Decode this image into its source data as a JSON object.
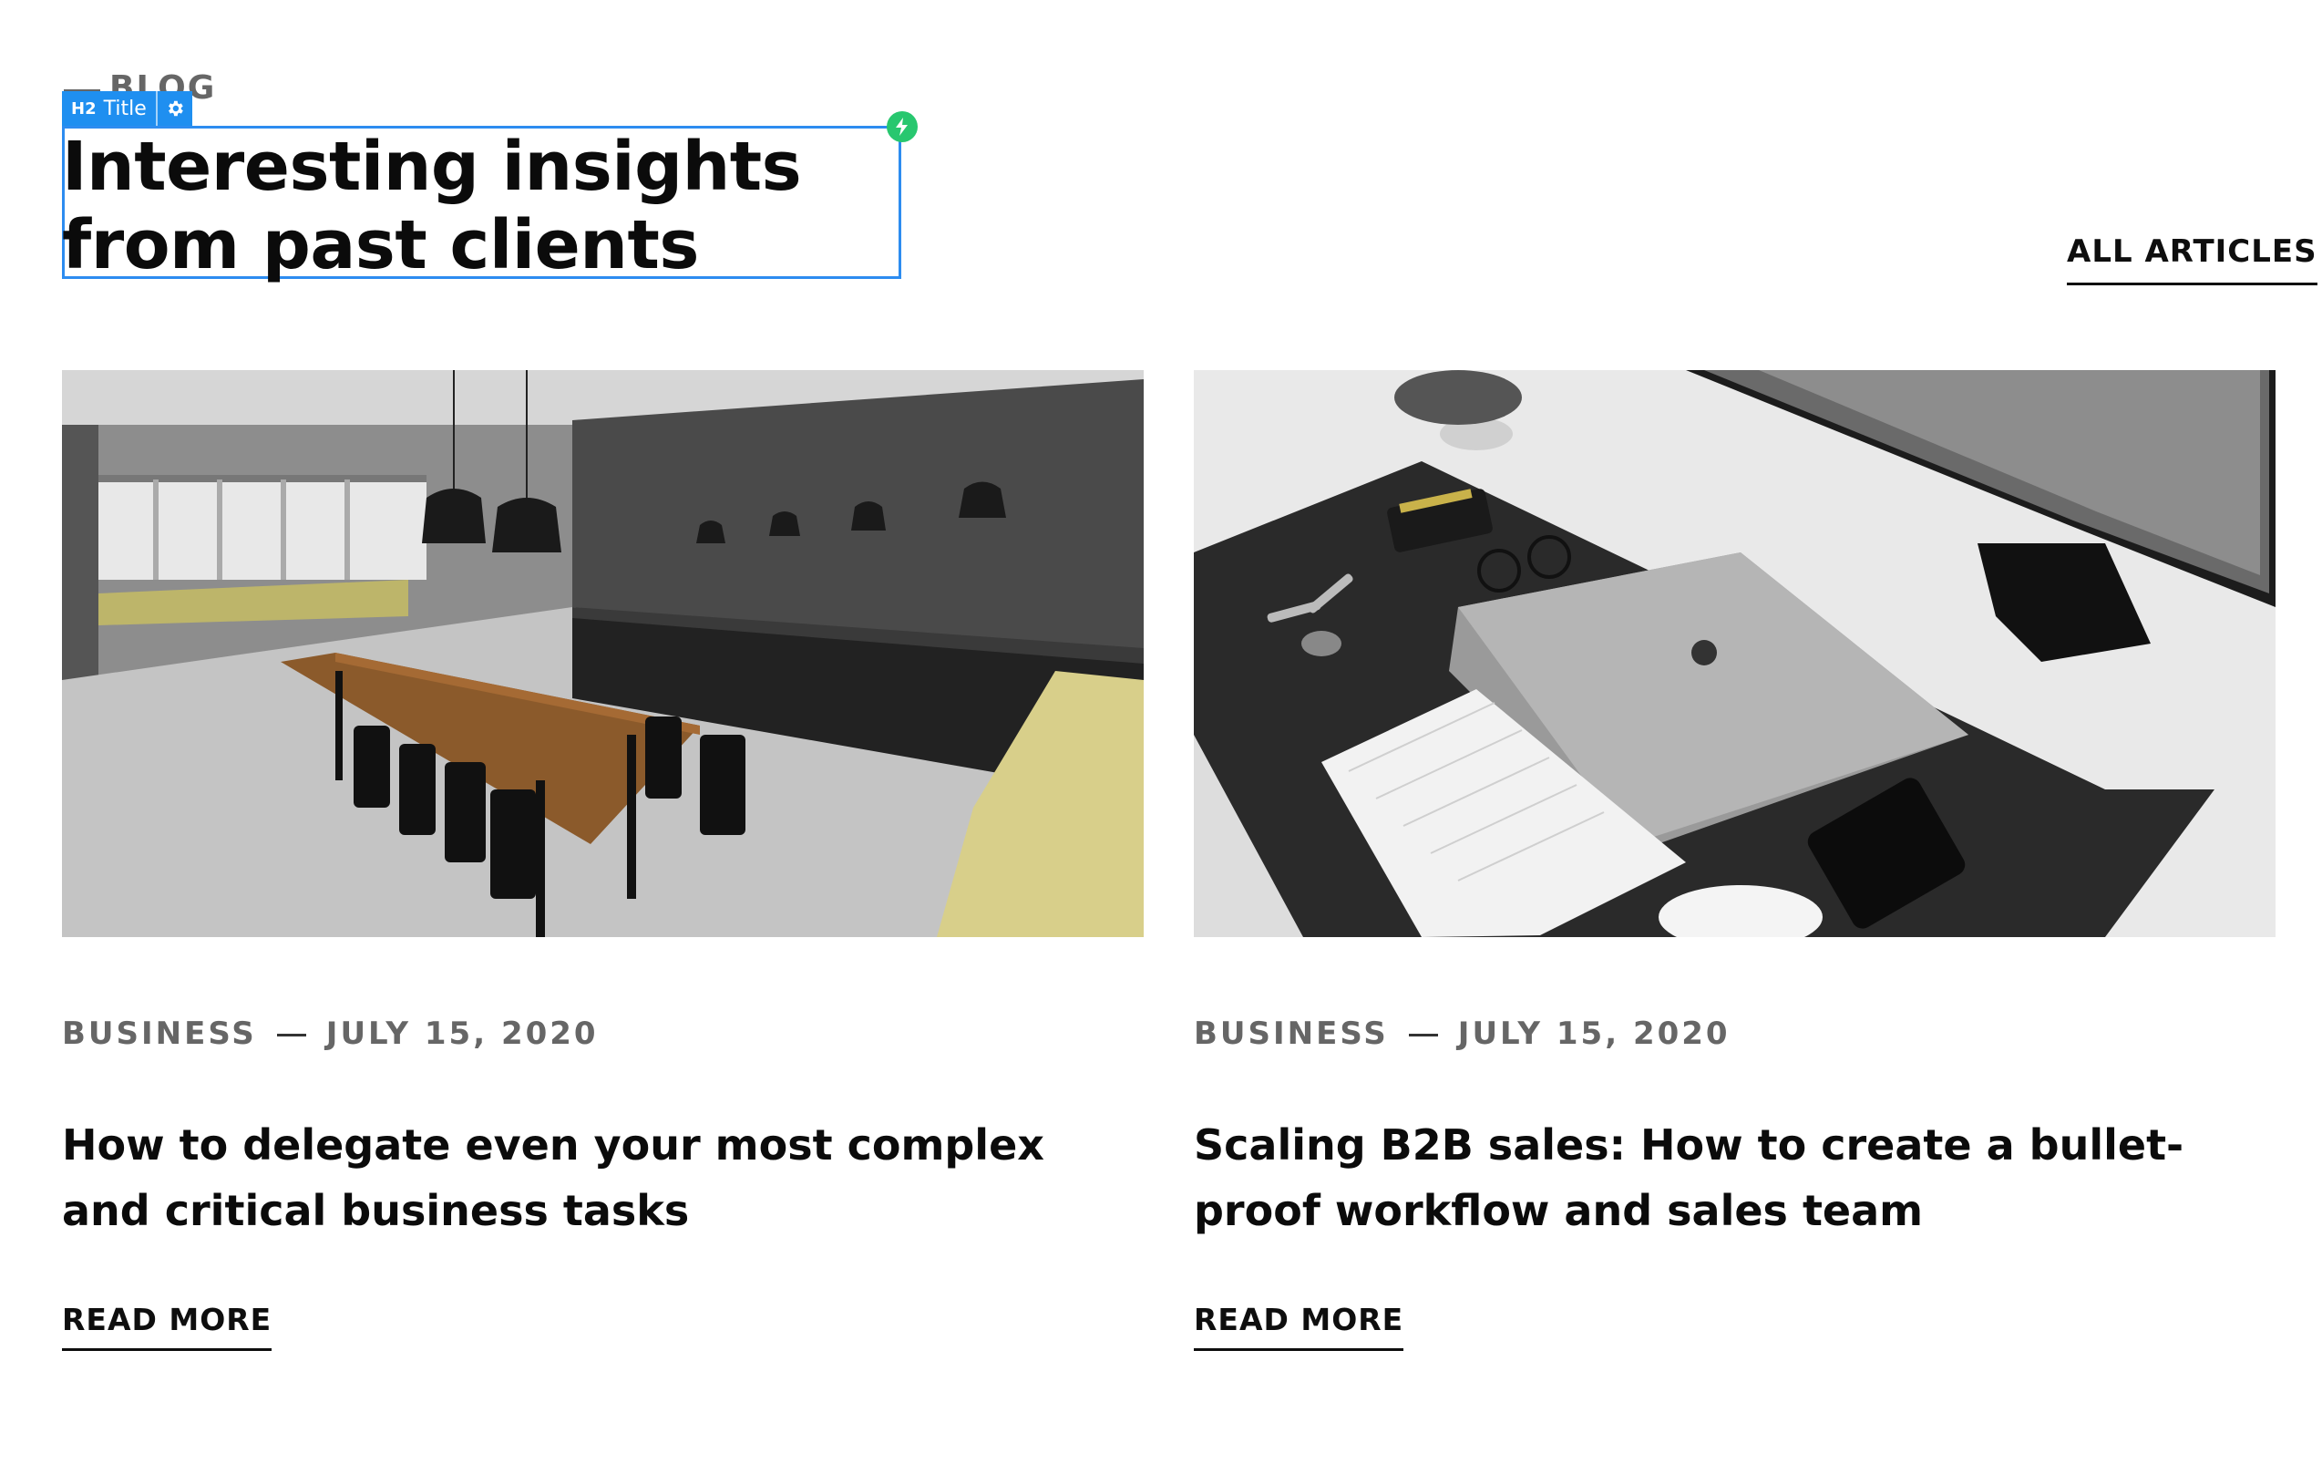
{
  "header": {
    "eyebrow": "BLOG",
    "title": "Interesting insights from past clients",
    "all_articles_label": "ALL ARTICLES"
  },
  "editor": {
    "tag_level": "H2",
    "tag_label": "Title",
    "accent_color": "#1f8ff0",
    "bolt_color": "#28c76f",
    "icons": [
      "gear-icon",
      "lightning-icon"
    ]
  },
  "cards": [
    {
      "image": "kitchen-dining-photo",
      "category": "BUSINESS",
      "date": "JULY 15, 2020",
      "title": "How to delegate even your most complex and critical business tasks",
      "cta": "READ MORE"
    },
    {
      "image": "desk-laptop-photo",
      "category": "BUSINESS",
      "date": "JULY 15, 2020",
      "title": "Scaling B2B sales: How to create a bullet-proof workflow and sales team",
      "cta": "READ MORE"
    }
  ]
}
